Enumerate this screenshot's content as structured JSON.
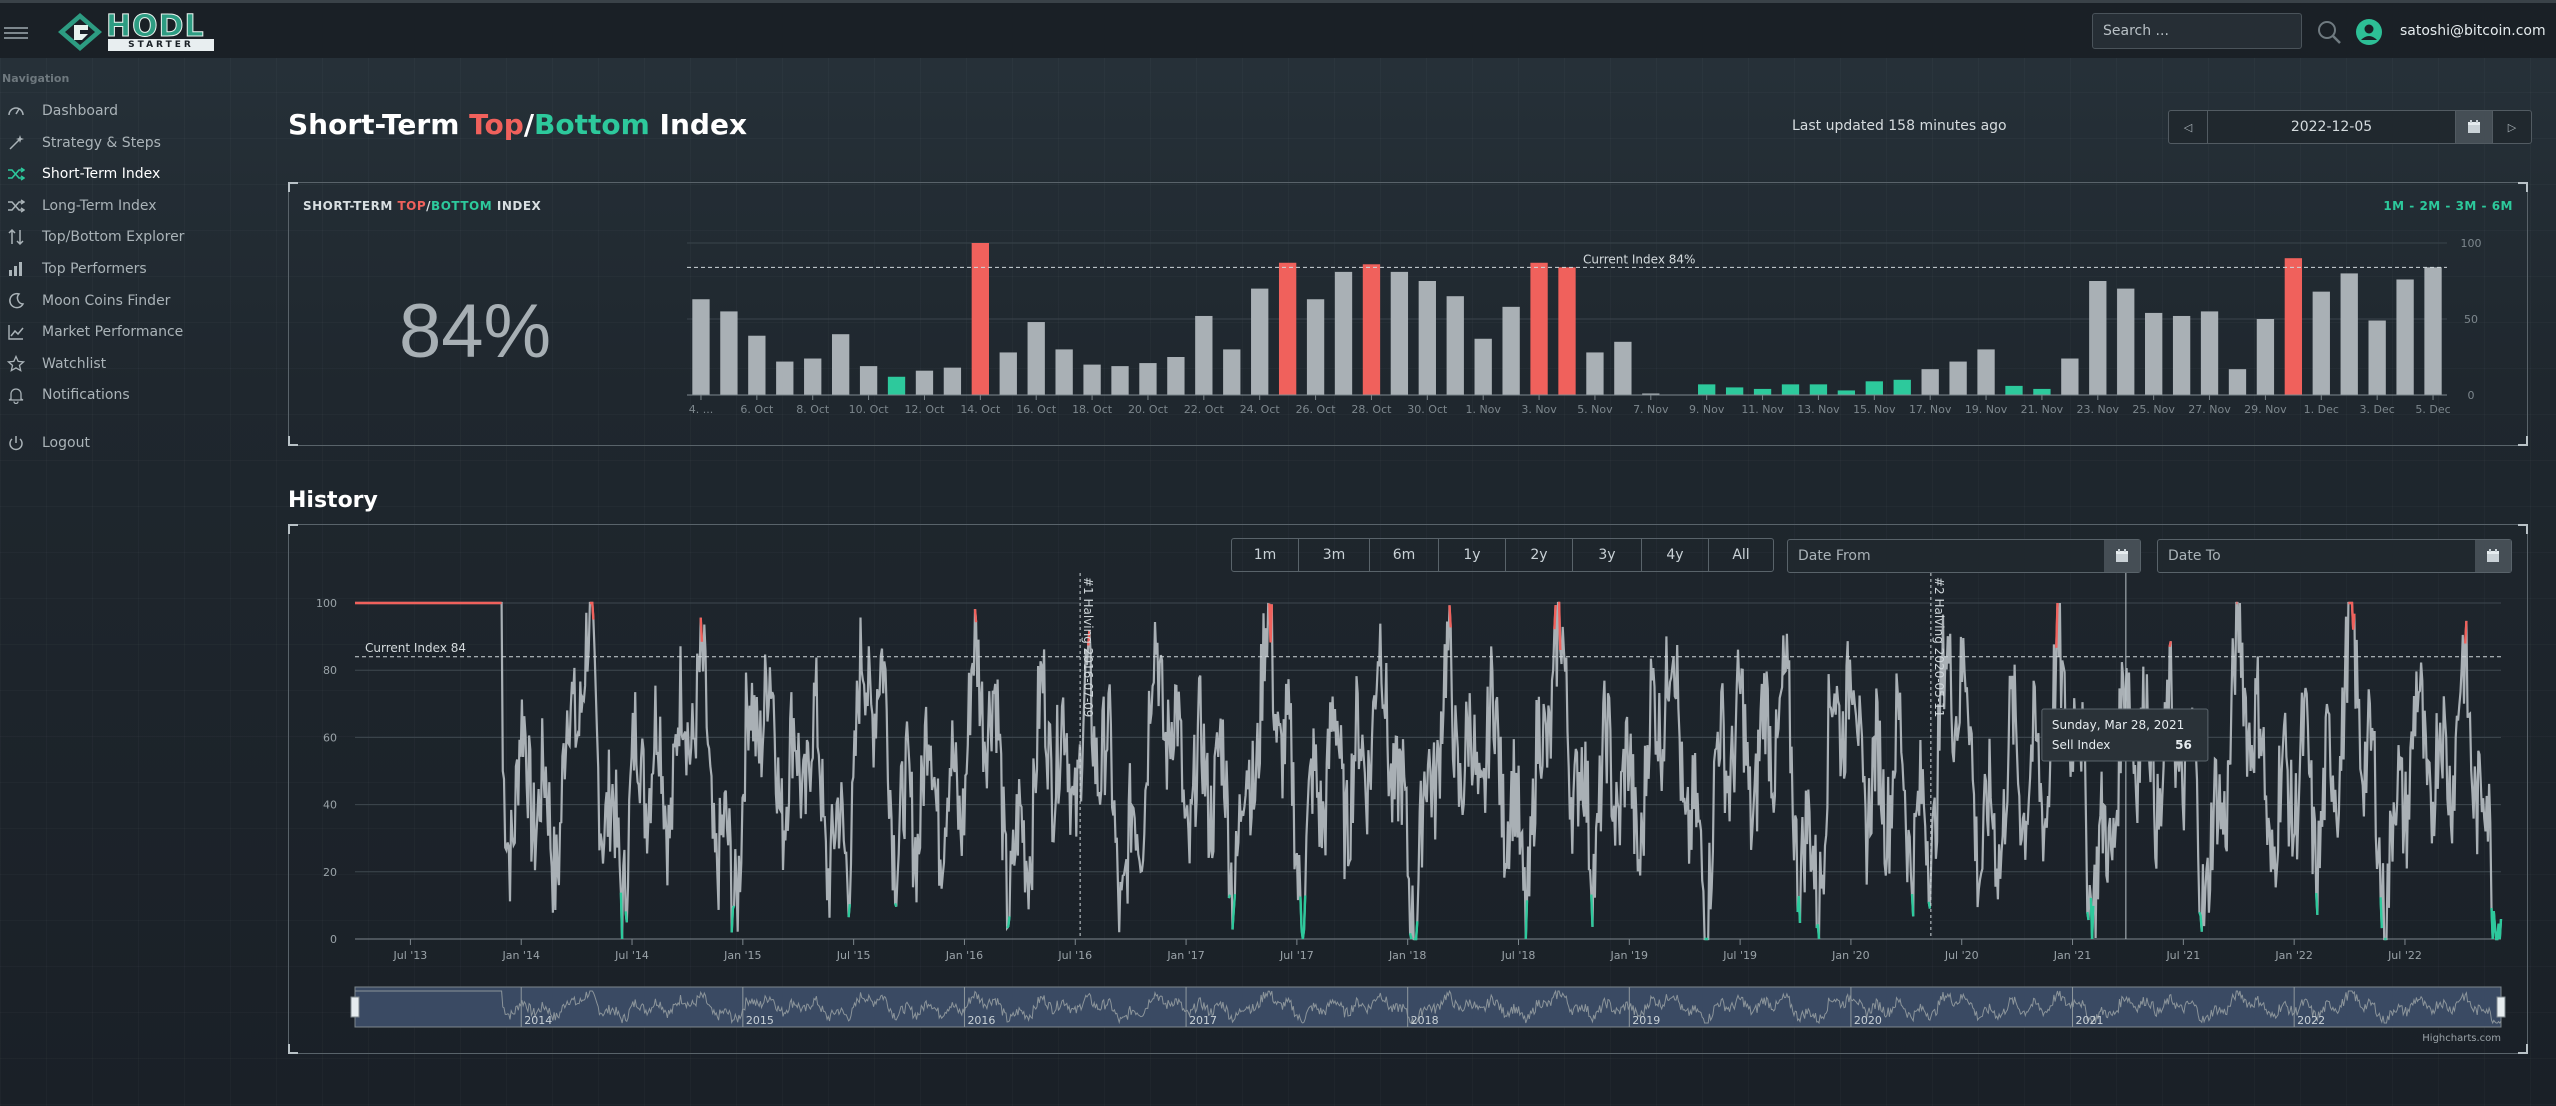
{
  "header": {
    "logo_top": "HODL",
    "logo_bottom": "STARTER",
    "search_placeholder": "Search ...",
    "user_email": "satoshi@bitcoin.com"
  },
  "sidebar": {
    "title": "Navigation",
    "items": [
      {
        "label": "Dashboard",
        "icon": "gauge-icon"
      },
      {
        "label": "Strategy & Steps",
        "icon": "wand-icon"
      },
      {
        "label": "Short-Term Index",
        "icon": "shuffle-icon",
        "active": true
      },
      {
        "label": "Long-Term Index",
        "icon": "shuffle-icon"
      },
      {
        "label": "Top/Bottom Explorer",
        "icon": "sort-icon"
      },
      {
        "label": "Top Performers",
        "icon": "bar-chart-icon"
      },
      {
        "label": "Moon Coins Finder",
        "icon": "moon-icon"
      },
      {
        "label": "Market Performance",
        "icon": "line-chart-icon"
      },
      {
        "label": "Watchlist",
        "icon": "star-icon"
      },
      {
        "label": "Notifications",
        "icon": "bell-icon"
      },
      {
        "label": "Logout",
        "icon": "power-icon"
      }
    ]
  },
  "page": {
    "title_pre": "Short-Term ",
    "title_top": "Top",
    "title_sep": "/",
    "title_bottom": "Bottom",
    "title_post": " Index",
    "last_updated": "Last updated 158 minutes ago",
    "selected_date": "2022-12-05"
  },
  "index_panel": {
    "title_pre": "SHORT-TERM ",
    "title_top": "TOP",
    "title_sep": "/",
    "title_bottom": "BOTTOM",
    "title_post": " INDEX",
    "ranges": "1M - 2M - 3M - 6M",
    "value": "84%"
  },
  "history": {
    "title": "History",
    "ranges": [
      "1m",
      "3m",
      "6m",
      "1y",
      "2y",
      "3y",
      "4y",
      "All"
    ],
    "date_from_placeholder": "Date From",
    "date_to_placeholder": "Date To",
    "credit": "Highcharts.com"
  },
  "colors": {
    "top": "#f0615c",
    "bottom": "#2dc99c",
    "neutral": "#a9b0b5"
  },
  "chart_data": [
    {
      "type": "bar",
      "plot_line_label": "Current Index 84%",
      "plot_line_value": 84,
      "ylim": [
        0,
        100
      ],
      "yticks": [
        0,
        50,
        100
      ],
      "tick_labels": [
        "4. ...",
        "6. Oct",
        "8. Oct",
        "10. Oct",
        "12. Oct",
        "14. Oct",
        "16. Oct",
        "18. Oct",
        "20. Oct",
        "22. Oct",
        "24. Oct",
        "26. Oct",
        "28. Oct",
        "30. Oct",
        "1. Nov",
        "3. Nov",
        "5. Nov",
        "7. Nov",
        "9. Nov",
        "11. Nov",
        "13. Nov",
        "15. Nov",
        "17. Nov",
        "19. Nov",
        "21. Nov",
        "23. Nov",
        "25. Nov",
        "27. Nov",
        "29. Nov",
        "1. Dec",
        "3. Dec",
        "5. Dec"
      ],
      "values": [
        63,
        55,
        39,
        22,
        24,
        40,
        19,
        12,
        16,
        18,
        100,
        28,
        48,
        30,
        20,
        19,
        21,
        25,
        52,
        30,
        70,
        87,
        63,
        81,
        86,
        81,
        75,
        65,
        37,
        58,
        87,
        84,
        28,
        35,
        1,
        0,
        7,
        5,
        4,
        7,
        7,
        3,
        9,
        10,
        17,
        22,
        30,
        6,
        4,
        24,
        75,
        70,
        54,
        52,
        55,
        17,
        50,
        90,
        68,
        80,
        49,
        76,
        84
      ],
      "colors": [
        "n",
        "n",
        "n",
        "n",
        "n",
        "n",
        "n",
        "g",
        "n",
        "n",
        "r",
        "n",
        "n",
        "n",
        "n",
        "n",
        "n",
        "n",
        "n",
        "n",
        "n",
        "r",
        "n",
        "n",
        "r",
        "n",
        "n",
        "n",
        "n",
        "n",
        "r",
        "r",
        "n",
        "n",
        "n",
        "n",
        "g",
        "g",
        "g",
        "g",
        "g",
        "g",
        "g",
        "g",
        "n",
        "n",
        "n",
        "g",
        "g",
        "n",
        "n",
        "n",
        "n",
        "n",
        "n",
        "n",
        "n",
        "r",
        "n",
        "n",
        "n",
        "n",
        "n"
      ]
    },
    {
      "type": "line",
      "plot_line_label": "Current Index 84",
      "plot_line_value": 84,
      "ylim": [
        0,
        100
      ],
      "yticks": [
        0,
        20,
        40,
        60,
        80,
        100
      ],
      "x_labels": [
        "Jul '13",
        "Jan '14",
        "Jul '14",
        "Jan '15",
        "Jul '15",
        "Jan '16",
        "Jul '16",
        "Jan '17",
        "Jul '17",
        "Jan '18",
        "Jul '18",
        "Jan '19",
        "Jul '19",
        "Jan '20",
        "Jul '20",
        "Jan '21",
        "Jul '21",
        "Jan '22",
        "Jul '22"
      ],
      "x_start": "2013-04",
      "x_end": "2022-12",
      "events": [
        {
          "label": "#1 Halving 2016-07-09",
          "date": "2016-07-09"
        },
        {
          "label": "#2 Halving 2020-05-11",
          "date": "2020-05-11"
        }
      ],
      "tooltip": {
        "date": "Sunday, Mar 28, 2021",
        "series": "Sell Index",
        "value": "56"
      },
      "navigator_labels": [
        "2014",
        "2015",
        "2016",
        "2017",
        "2018",
        "2019",
        "2020",
        "2021",
        "2022"
      ]
    }
  ]
}
